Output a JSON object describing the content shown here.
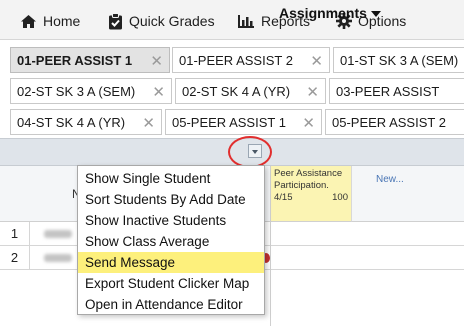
{
  "nav": {
    "home": "Home",
    "quick_grades": "Quick Grades",
    "reports": "Reports",
    "options": "Options"
  },
  "tabs": {
    "row1": [
      {
        "label": "01-PEER ASSIST 1",
        "active": true,
        "closable": true
      },
      {
        "label": "01-PEER ASSIST 2",
        "closable": true
      },
      {
        "label": "01-ST SK 3 A (SEM)",
        "closable": false
      }
    ],
    "row2": [
      {
        "label": "02-ST SK 3 A (SEM)",
        "closable": true
      },
      {
        "label": "02-ST SK 4 A (YR)",
        "closable": true
      },
      {
        "label": "03-PEER ASSIST",
        "closable": false
      }
    ],
    "row3": [
      {
        "label": "04-ST SK 4 A (YR)",
        "closable": true
      },
      {
        "label": "05-PEER ASSIST 1",
        "closable": true
      },
      {
        "label": "05-PEER ASSIST 2",
        "closable": false
      }
    ]
  },
  "grid": {
    "assignments_label": "Assignments",
    "name_header": "N",
    "peer_column": {
      "title": "Peer Assistance Participation.",
      "date": "4/15",
      "points": "100"
    },
    "new_link": "New...",
    "rows": [
      {
        "num": "1"
      },
      {
        "num": "2"
      }
    ]
  },
  "context_menu": {
    "items": [
      "Show Single Student",
      "Sort Students By Add Date",
      "Show Inactive Students",
      "Show Class Average",
      "Send Message",
      "Export Student Clicker Map",
      "Open in Attendance Editor"
    ],
    "highlighted_index": 4
  },
  "colors": {
    "menu_highlight": "#fdf07c",
    "peer_column_bg": "#fbf4b3",
    "annotation_circle": "#e12e2e",
    "link": "#4a76b5"
  }
}
